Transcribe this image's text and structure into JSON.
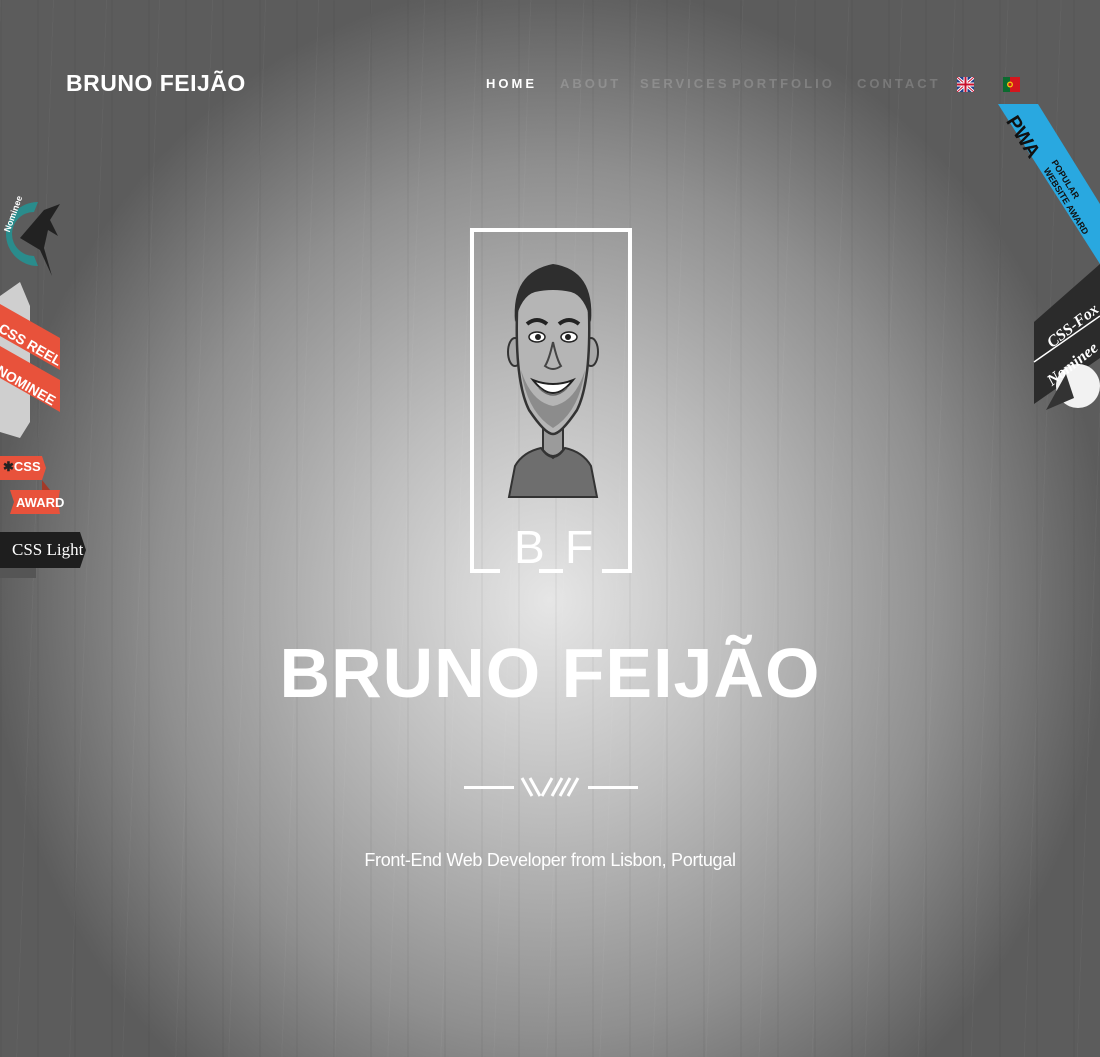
{
  "header": {
    "brand": "BRUNO FEIJÃO",
    "nav": [
      {
        "label": "HOME",
        "active": true
      },
      {
        "label": "ABOUT",
        "active": false
      },
      {
        "label": "SERVICES",
        "active": false
      },
      {
        "label": "PORTFOLIO",
        "active": false
      },
      {
        "label": "CONTACT",
        "active": false
      }
    ],
    "languages": [
      {
        "name": "English",
        "icon": "uk-flag-icon"
      },
      {
        "name": "Portuguese",
        "icon": "portugal-flag-icon"
      }
    ]
  },
  "hero": {
    "monogram_left": "B",
    "monogram_right": "F",
    "name": "BRUNO FEIJÃO",
    "tagline": "Front-End Web Developer from Lisbon, Portugal"
  },
  "awards_left": [
    {
      "label": "Nominee",
      "icon": "hummingbird-nominee-icon"
    },
    {
      "line1": "CSS REEL",
      "line2": "NOMINEE"
    },
    {
      "line1": "CSS",
      "line2": "AWARD"
    },
    {
      "label": "CSS Light"
    }
  ],
  "awards_right": [
    {
      "label": "PWA",
      "line1": "POPULAR",
      "line2": "WEBSITE AWARD"
    },
    {
      "line1": "CSS-Fox",
      "line2": "Nominee"
    }
  ],
  "colors": {
    "accent_red": "#e8523b",
    "pwa_blue": "#29a8e0",
    "teal": "#2a8c8c",
    "dark": "#2b2b2b"
  }
}
